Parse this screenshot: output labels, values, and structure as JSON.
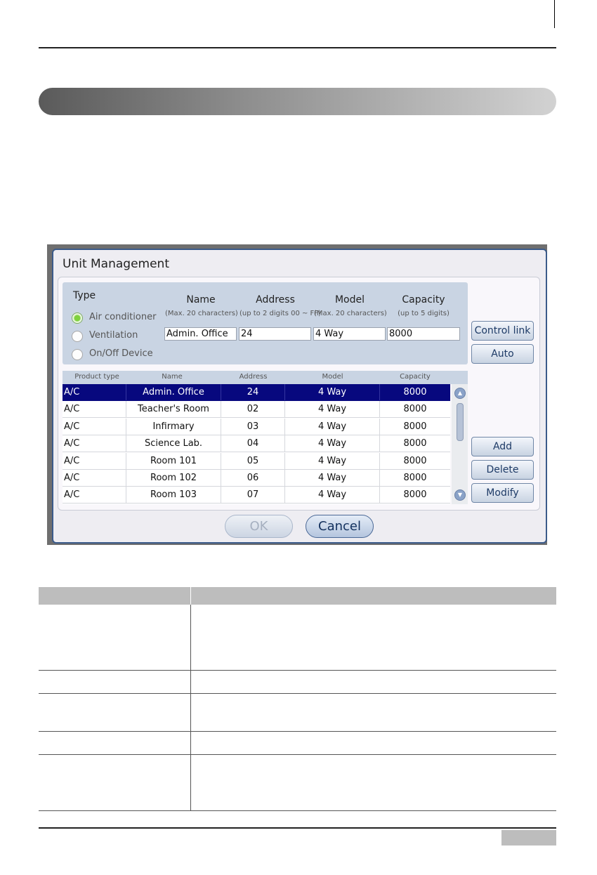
{
  "dialog": {
    "title": "Unit Management"
  },
  "form": {
    "type_label": "Type",
    "types": [
      {
        "label": "Air conditioner",
        "selected": true
      },
      {
        "label": "Ventilation",
        "selected": false
      },
      {
        "label": "On/Off Device",
        "selected": false
      }
    ],
    "columns": [
      {
        "label": "Name",
        "hint": "(Max. 20 characters)",
        "value": "Admin. Office"
      },
      {
        "label": "Address",
        "hint": "(up to 2 digits 00 ~ FF)",
        "value": "24"
      },
      {
        "label": "Model",
        "hint": "(Max. 20 characters)",
        "value": "4 Way"
      },
      {
        "label": "Capacity",
        "hint": "(up to 5 digits)",
        "value": "8000"
      }
    ]
  },
  "side_buttons": {
    "control_link": "Control link",
    "auto": "Auto",
    "add": "Add",
    "delete": "Delete",
    "modify": "Modify"
  },
  "table": {
    "headers": [
      "Product type",
      "Name",
      "Address",
      "Model",
      "Capacity"
    ],
    "rows": [
      [
        "A/C",
        "Admin. Office",
        "24",
        "4 Way",
        "8000"
      ],
      [
        "A/C",
        "Teacher's Room",
        "02",
        "4 Way",
        "8000"
      ],
      [
        "A/C",
        "Infirmary",
        "03",
        "4 Way",
        "8000"
      ],
      [
        "A/C",
        "Science Lab.",
        "04",
        "4 Way",
        "8000"
      ],
      [
        "A/C",
        "Room 101",
        "05",
        "4 Way",
        "8000"
      ],
      [
        "A/C",
        "Room 102",
        "06",
        "4 Way",
        "8000"
      ],
      [
        "A/C",
        "Room 103",
        "07",
        "4 Way",
        "8000"
      ]
    ],
    "selected_row": 0
  },
  "footer_buttons": {
    "ok": "OK",
    "cancel": "Cancel"
  },
  "colors": {
    "selection": "#07087e",
    "panel": "#c9d4e3",
    "accent": "#7fd13e"
  },
  "icons": [
    "radio-icon",
    "scroll-up-icon",
    "scroll-down-icon"
  ]
}
